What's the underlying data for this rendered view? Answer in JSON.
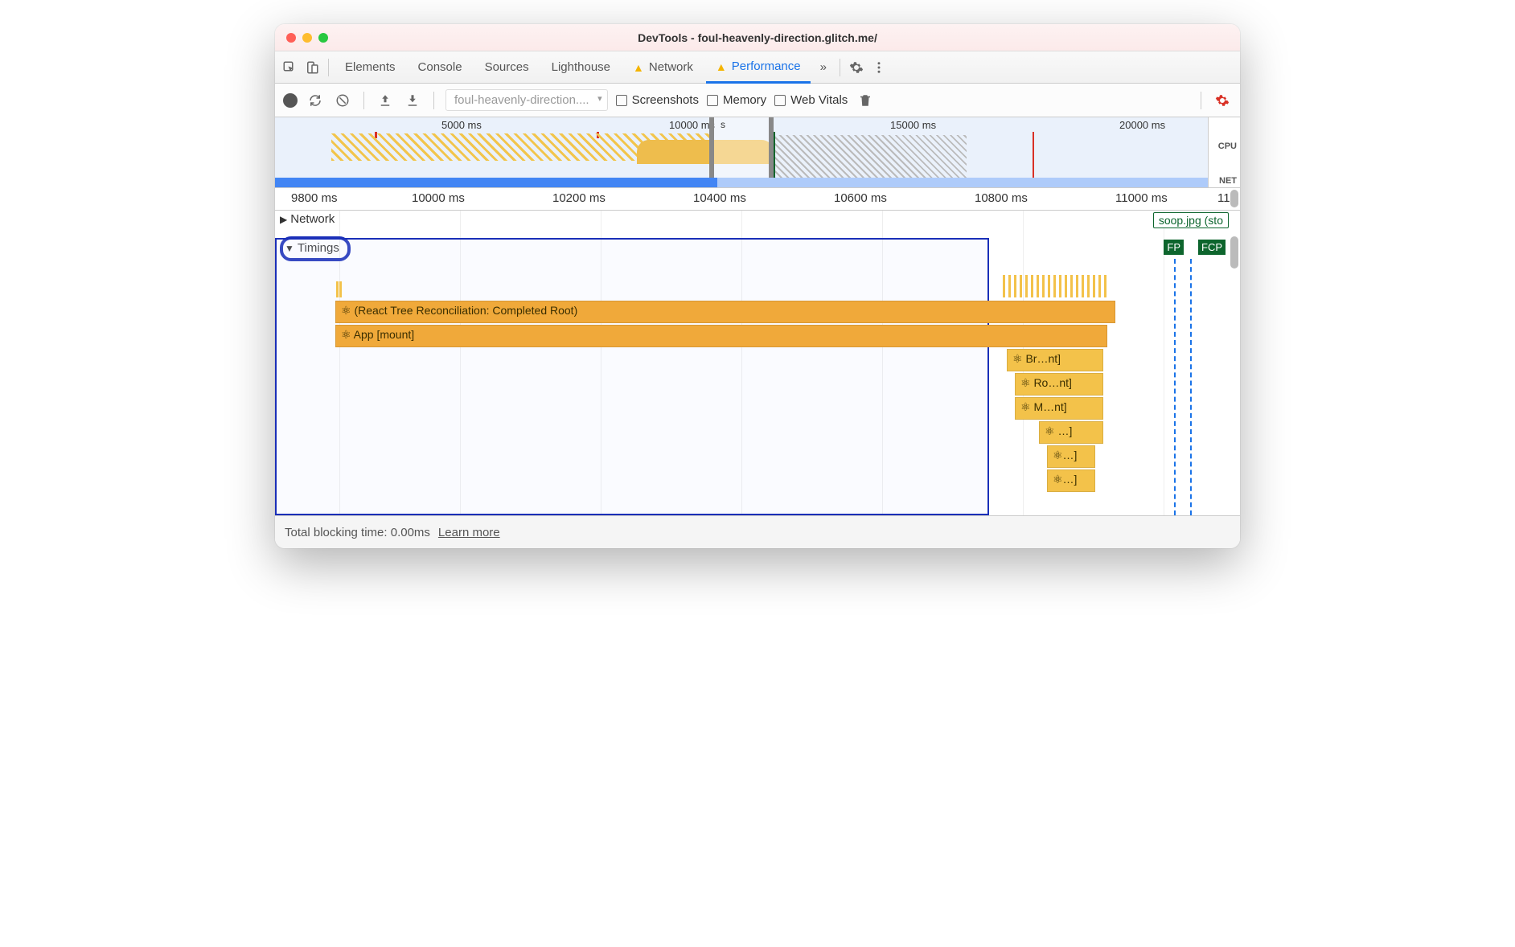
{
  "window": {
    "title": "DevTools - foul-heavenly-direction.glitch.me/"
  },
  "tabs": {
    "items": [
      "Elements",
      "Console",
      "Sources",
      "Lighthouse",
      "Network",
      "Performance"
    ],
    "active": "Performance",
    "moreGlyph": "»"
  },
  "toolbar": {
    "selector": "foul-heavenly-direction....",
    "screenshots": "Screenshots",
    "memory": "Memory",
    "webvitals": "Web Vitals"
  },
  "overview": {
    "ticks": [
      "5000 ms",
      "10000 ms",
      "15000 ms",
      "20000 ms"
    ],
    "rightLabels": {
      "cpu": "CPU",
      "net": "NET"
    }
  },
  "ruler": [
    "9800 ms",
    "10000 ms",
    "10200 ms",
    "10400 ms",
    "10600 ms",
    "10800 ms",
    "11000 ms",
    "11"
  ],
  "sections": {
    "network": "Network",
    "timings": "Timings"
  },
  "netItem": "soop.jpg (sto",
  "markers": {
    "fp": "FP",
    "fcp": "FCP"
  },
  "bars": {
    "reconcile": "⚛ (React Tree Reconciliation: Completed Root)",
    "appMount": "⚛ App [mount]",
    "br": "⚛ Br…nt]",
    "ro": "⚛ Ro…nt]",
    "m": "⚛ M…nt]",
    "s1": "⚛ …]",
    "s2": "⚛…]",
    "s3": "⚛…]"
  },
  "footer": {
    "tbt": "Total blocking time: 0.00ms",
    "learn": "Learn more"
  },
  "overview_s": "s"
}
